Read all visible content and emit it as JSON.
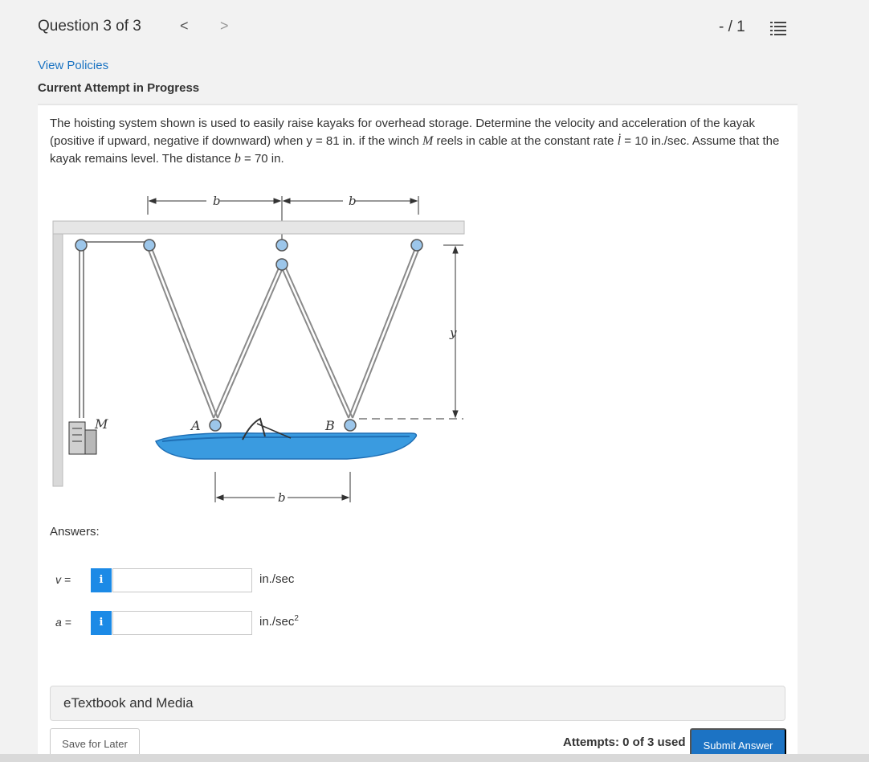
{
  "header": {
    "question_title": "Question 3 of 3",
    "prev_label": "<",
    "next_label": ">",
    "score": "- / 1"
  },
  "policies": {
    "view_policies": "View Policies",
    "attempt_status": "Current Attempt in Progress"
  },
  "problem": {
    "text_1": "The hoisting system shown is used to easily raise kayaks for overhead storage. Determine the velocity and acceleration of the kayak (positive if upward, negative if downward) when y = 81 in. if the winch ",
    "winch_symbol": "M",
    "text_2": " reels in cable at the constant rate ",
    "rate_symbol": "l̇",
    "text_3": " = 10 in./sec. Assume that the kayak remains level. The distance ",
    "dist_symbol": "b",
    "text_4": " = 70 in."
  },
  "figure": {
    "label_b": "b",
    "label_y": "y",
    "label_M": "M",
    "label_A": "A",
    "label_B": "B",
    "colors": {
      "kayak": "#3a9be0",
      "kayak_dark": "#1f6fb5",
      "beam": "#e4e4e4",
      "wall": "#d9d9d9",
      "pulley": "#7fb3e0",
      "cable": "#888888"
    }
  },
  "answers": {
    "label": "Answers:",
    "v": {
      "label": "v =",
      "info": "i",
      "value": "",
      "unit": "in./sec"
    },
    "a": {
      "label": "a =",
      "info": "i",
      "value": "",
      "unit": "in./sec",
      "unit_sup": "2"
    }
  },
  "etextbook": "eTextbook and Media",
  "footer": {
    "save_label": "Save for Later",
    "attempts": "Attempts: 0 of 3 used",
    "submit_label": "Submit Answer"
  }
}
